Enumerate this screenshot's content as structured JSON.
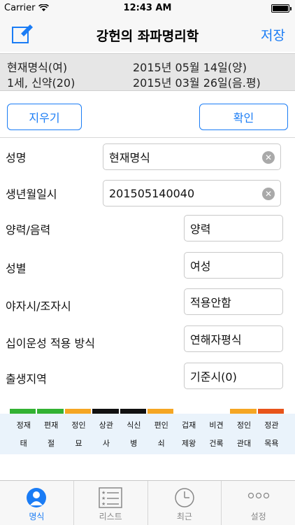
{
  "status_bar": {
    "carrier": "Carrier",
    "time": "12:43 AM",
    "battery_level": 1.0
  },
  "nav": {
    "title": "강헌의 좌파명리학",
    "save_label": "저장",
    "edit_icon": "edit-icon"
  },
  "info": {
    "line1_left": "현재명식(여)",
    "line2_left": "1세, 신약(20)",
    "line1_right": "2015년 05월 14일(양)",
    "line2_right": "2015년 03월 26일(음.평)"
  },
  "actions": {
    "clear_label": "지우기",
    "confirm_label": "확인"
  },
  "form": {
    "name": {
      "label": "성명",
      "value": "현재명식"
    },
    "birth": {
      "label": "생년월일시",
      "value": "201505140040"
    },
    "calendar": {
      "label": "양력/음력",
      "value": "양력"
    },
    "gender": {
      "label": "성별",
      "value": "여성"
    },
    "night_hour": {
      "label": "야자시/조자시",
      "value": "적용안함"
    },
    "twelve_stage": {
      "label": "십이운성 적용 방식",
      "value": "연해자평식"
    },
    "birthplace": {
      "label": "출생지역",
      "value": "기준시(0)"
    }
  },
  "grid": {
    "colors": [
      "#33b233",
      "#33b233",
      "#f5a623",
      "#111111",
      "#111111",
      "#f5a623",
      "#ffffff",
      "#ffffff",
      "#f5a623",
      "#e8541a"
    ],
    "row1": [
      "정재",
      "편재",
      "정인",
      "상관",
      "식신",
      "편인",
      "겁재",
      "비견",
      "정인",
      "정관"
    ],
    "row2": [
      "태",
      "절",
      "묘",
      "사",
      "병",
      "쇠",
      "제왕",
      "건록",
      "관대",
      "목욕"
    ]
  },
  "tabs": [
    {
      "label": "명식",
      "icon": "person-icon",
      "active": true
    },
    {
      "label": "리스트",
      "icon": "list-icon",
      "active": false
    },
    {
      "label": "최근",
      "icon": "clock-icon",
      "active": false
    },
    {
      "label": "설정",
      "icon": "more-icon",
      "active": false
    }
  ],
  "colors": {
    "accent": "#1a7cf5"
  }
}
